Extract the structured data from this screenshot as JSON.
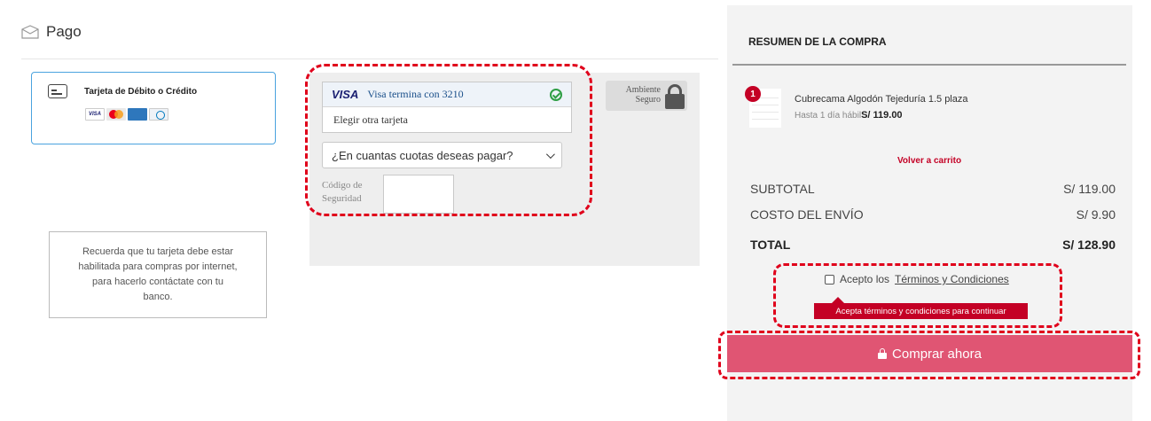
{
  "payment": {
    "header": "Pago",
    "method_title": "Tarjeta de Débito o Crédito",
    "brands": [
      "VISA",
      "Mastercard",
      "American Express",
      "Diners Club"
    ],
    "saved_card_brand": "VISA",
    "saved_card_label": "Visa termina con 3210",
    "other_card": "Elegir otra tarjeta",
    "installments_placeholder": "¿En cuantas cuotas deseas pagar?",
    "cvv_label": "Código de Seguridad",
    "secure_label": "Ambiente Seguro",
    "notice": "Recuerda que tu tarjeta debe estar habilitada para compras por internet, para hacerlo contáctate con tu banco."
  },
  "summary": {
    "title": "RESUMEN DE LA COMPRA",
    "product": {
      "qty": "1",
      "name": "Cubrecama Algodón Tejeduría 1.5 plaza",
      "delivery": "Hasta 1 día hábil",
      "price": "S/ 119.00"
    },
    "back_to_cart": "Volver a carrito",
    "subtotal_label": "SUBTOTAL",
    "subtotal_value": "S/ 119.00",
    "shipping_label": "COSTO DEL ENVÍO",
    "shipping_value": "S/ 9.90",
    "total_label": "TOTAL",
    "total_value": "S/ 128.90",
    "terms_prefix": "Acepto los",
    "terms_link": "Términos y Condiciones",
    "terms_error": "Acepta términos y condiciones para continuar",
    "buy_button": "Comprar ahora"
  },
  "colors": {
    "accent": "#c40025",
    "buy_button": "#e05573",
    "annotation": "#e0001b",
    "card_border": "#4aa3df"
  },
  "icons": [
    "envelope-icon",
    "credit-card-icon",
    "check-circle-icon",
    "lock-icon",
    "chevron-down-icon"
  ]
}
